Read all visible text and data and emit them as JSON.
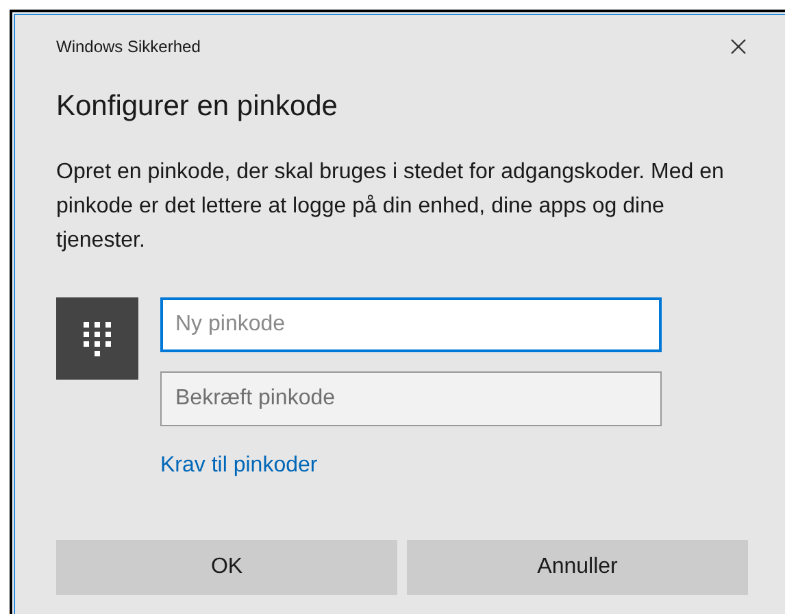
{
  "window": {
    "title": "Windows Sikkerhed"
  },
  "heading": "Konfigurer en pinkode",
  "description": "Opret en pinkode, der skal bruges i stedet for adgangskoder. Med en pinkode er det lettere at logge på din enhed, dine apps og dine tjenester.",
  "fields": [
    {
      "placeholder": "Ny pinkode",
      "focused": true
    },
    {
      "placeholder": "Bekræft pinkode",
      "focused": false
    }
  ],
  "link": "Krav til pinkoder",
  "buttons": [
    "OK",
    "Annuller"
  ]
}
